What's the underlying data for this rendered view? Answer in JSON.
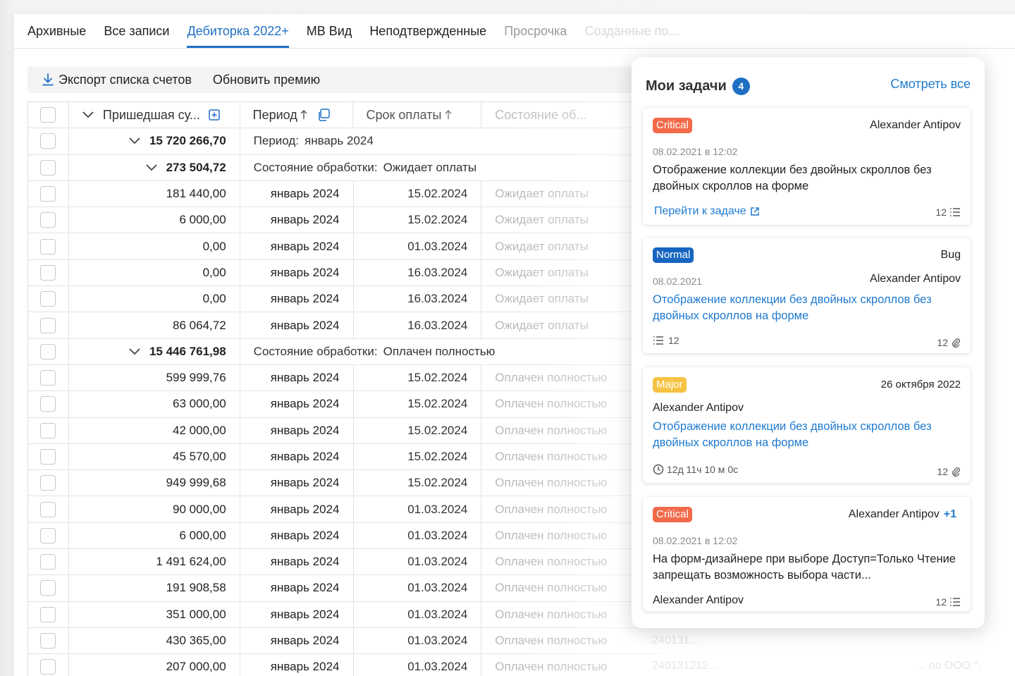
{
  "tabs": [
    "Архивные",
    "Все записи",
    "Дебиторка 2022+",
    "MB Вид",
    "Неподтвержденные",
    "Просрочка",
    "Созданные по..."
  ],
  "active_tab": "Дебиторка 2022+",
  "toolbar": {
    "export_label": "Экспорт списка счетов",
    "refresh_label": "Обновить премию"
  },
  "table": {
    "headers": {
      "amount": "Пришедшая су...",
      "period": "Период",
      "due": "Срок оплаты",
      "state": "Состояние об..."
    },
    "group1": {
      "total": "15 720 266,70",
      "key": "Период:",
      "value": "январь 2024"
    },
    "group2": {
      "total": "273 504,72",
      "key": "Состояние обработки:",
      "value": "Ожидает оплаты"
    },
    "group3": {
      "total": "15 446 761,98",
      "key": "Состояние обработки:",
      "value": "Оплачен полностью"
    },
    "rows_a": [
      {
        "amount": "181 440,00",
        "period": "январь 2024",
        "due": "15.02.2024",
        "state": "Ожидает оплаты"
      },
      {
        "amount": "6 000,00",
        "period": "январь 2024",
        "due": "15.02.2024",
        "state": "Ожидает оплаты"
      },
      {
        "amount": "0,00",
        "period": "январь 2024",
        "due": "01.03.2024",
        "state": "Ожидает оплаты"
      },
      {
        "amount": "0,00",
        "period": "январь 2024",
        "due": "16.03.2024",
        "state": "Ожидает оплаты"
      },
      {
        "amount": "0,00",
        "period": "январь 2024",
        "due": "16.03.2024",
        "state": "Ожидает оплаты"
      },
      {
        "amount": "86 064,72",
        "period": "январь 2024",
        "due": "16.03.2024",
        "state": "Ожидает оплаты"
      }
    ],
    "rows_b": [
      {
        "amount": "599 999,76",
        "period": "январь 2024",
        "due": "15.02.2024",
        "state": "Оплачен полностью"
      },
      {
        "amount": "63 000,00",
        "period": "январь 2024",
        "due": "15.02.2024",
        "state": "Оплачен полностью"
      },
      {
        "amount": "42 000,00",
        "period": "январь 2024",
        "due": "15.02.2024",
        "state": "Оплачен полностью"
      },
      {
        "amount": "45 570,00",
        "period": "январь 2024",
        "due": "15.02.2024",
        "state": "Оплачен полностью"
      },
      {
        "amount": "949 999,68",
        "period": "январь 2024",
        "due": "15.02.2024",
        "state": "Оплачен полностью"
      },
      {
        "amount": "90 000,00",
        "period": "январь 2024",
        "due": "01.03.2024",
        "state": "Оплачен полностью"
      },
      {
        "amount": "6 000,00",
        "period": "январь 2024",
        "due": "01.03.2024",
        "state": "Оплачен полностью"
      },
      {
        "amount": "1 491 624,00",
        "period": "январь 2024",
        "due": "01.03.2024",
        "state": "Оплачен полностью"
      },
      {
        "amount": "191 908,58",
        "period": "январь 2024",
        "due": "01.03.2024",
        "state": "Оплачен полностью"
      },
      {
        "amount": "351 000,00",
        "period": "январь 2024",
        "due": "01.03.2024",
        "state": "Оплачен полностью"
      },
      {
        "amount": "430 365,00",
        "period": "январь 2024",
        "due": "01.03.2024",
        "state": "Оплачен полностью"
      },
      {
        "amount": "207 000,00",
        "period": "январь 2024",
        "due": "01.03.2024",
        "state": "Оплачен полностью"
      }
    ]
  },
  "background_text": {
    "code1": "240131...",
    "code2": "240131212...",
    "org": "... по ООО \"."
  },
  "tasks": {
    "title": "Мои задачи",
    "count": "4",
    "see_all": "Смотреть все",
    "cards": [
      {
        "priority": "Critical",
        "assignee": "Alexander Antipov",
        "date": "08.02.2021 в 12:02",
        "description": "Отображение коллекции без двойных скроллов без двойных скроллов на форме",
        "link": "Перейти к задаче",
        "count": "12"
      },
      {
        "priority": "Normal",
        "type": "Bug",
        "date": "08.02.2021",
        "assignee": "Alexander Antipov",
        "description": "Отображение коллекции без двойных скроллов без двойных скроллов на форме",
        "subtasks": "12",
        "attachments": "12"
      },
      {
        "priority": "Major",
        "date": "26 октября 2022",
        "assignee": "Alexander Antipov",
        "description": "Отображение коллекции без двойных скроллов без двойных скроллов на форме",
        "timer": "12д 11ч 10 м 0с",
        "attachments": "12"
      },
      {
        "priority": "Critical",
        "assignee": "Alexander Antipov",
        "extra": "+1",
        "date": "08.02.2021 в 12:02",
        "description": "На форм-дизайнере при выборе Доступ=Только Чтение запрещать возможность выбора части...",
        "author": "Alexander Antipov",
        "count": "12"
      }
    ]
  },
  "colors": {
    "accent": "#1f6fc4",
    "critical": "#f36a4a",
    "normal": "#1565c0",
    "major": "#f6c243"
  }
}
